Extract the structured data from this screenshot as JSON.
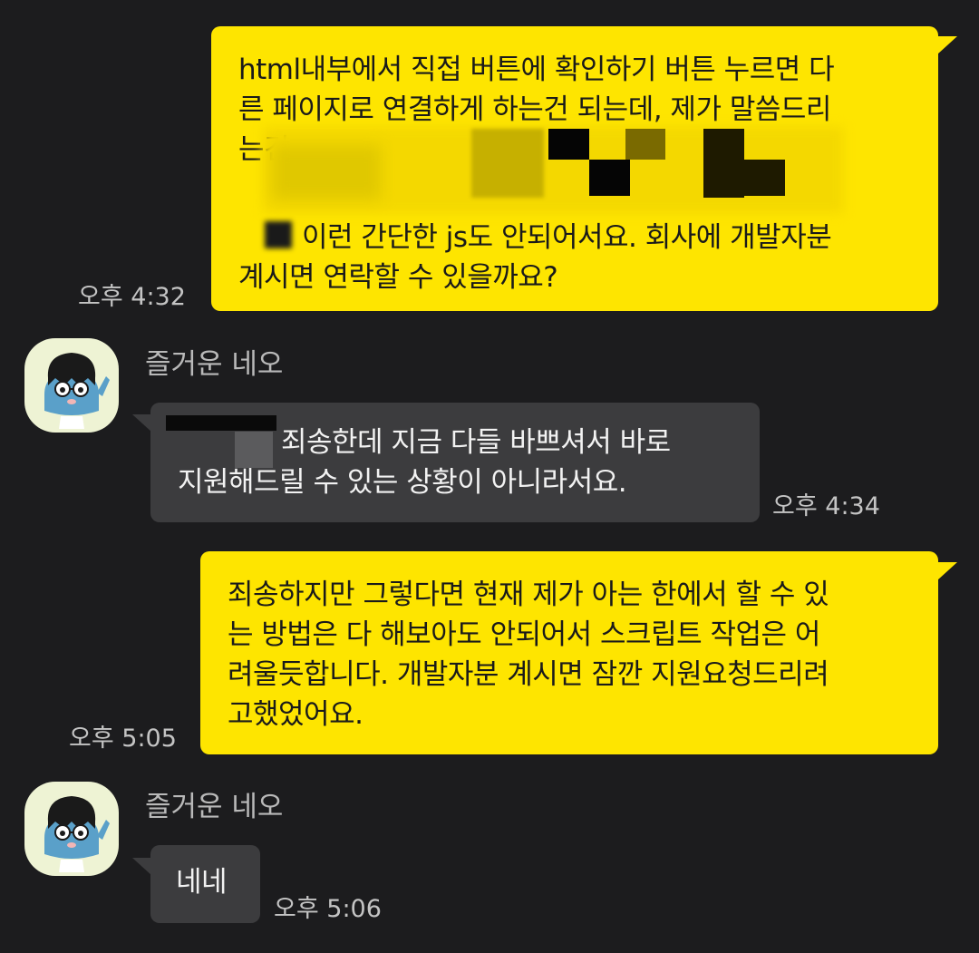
{
  "chat": {
    "messages": [
      {
        "sender": "me",
        "lines": [
          "html내부에서 직접 버튼에 확인하기 버튼 누르면 다",
          "른 페이지로 연결하게 하는건 되는데, 제가 말씀드리",
          "는건",
          "이런 간단한 js도 안되어서요. 회사에 개발자분",
          "계시면 연락할 수 있을까요?"
        ],
        "time": "오후 4:32"
      },
      {
        "sender": "partner",
        "name": "즐거운 네오",
        "lines": [
          "죄송한데 지금 다들 바쁘셔서 바로",
          "지원해드릴 수 있는 상황이 아니라서요."
        ],
        "time": "오후 4:34"
      },
      {
        "sender": "me",
        "lines": [
          "죄송하지만 그렇다면 현재 제가 아는 한에서 할 수 있",
          "는 방법은 다 해보아도 안되어서 스크립트 작업은 어",
          "려울듯합니다. 개발자분 계시면 잠깐 지원요청드리려",
          "고했었어요."
        ],
        "time": "오후 5:05"
      },
      {
        "sender": "partner",
        "name": "즐거운 네오",
        "lines": [
          "네네"
        ],
        "time": "오후 5:06"
      }
    ]
  },
  "colors": {
    "background": "#1c1c1e",
    "my_bubble": "#fee500",
    "partner_bubble": "#3c3c3e",
    "timestamp": "#c4c4c4",
    "avatar_bg": "#eef3d4"
  },
  "icons": {
    "avatar": "neo-character-avatar-icon"
  }
}
